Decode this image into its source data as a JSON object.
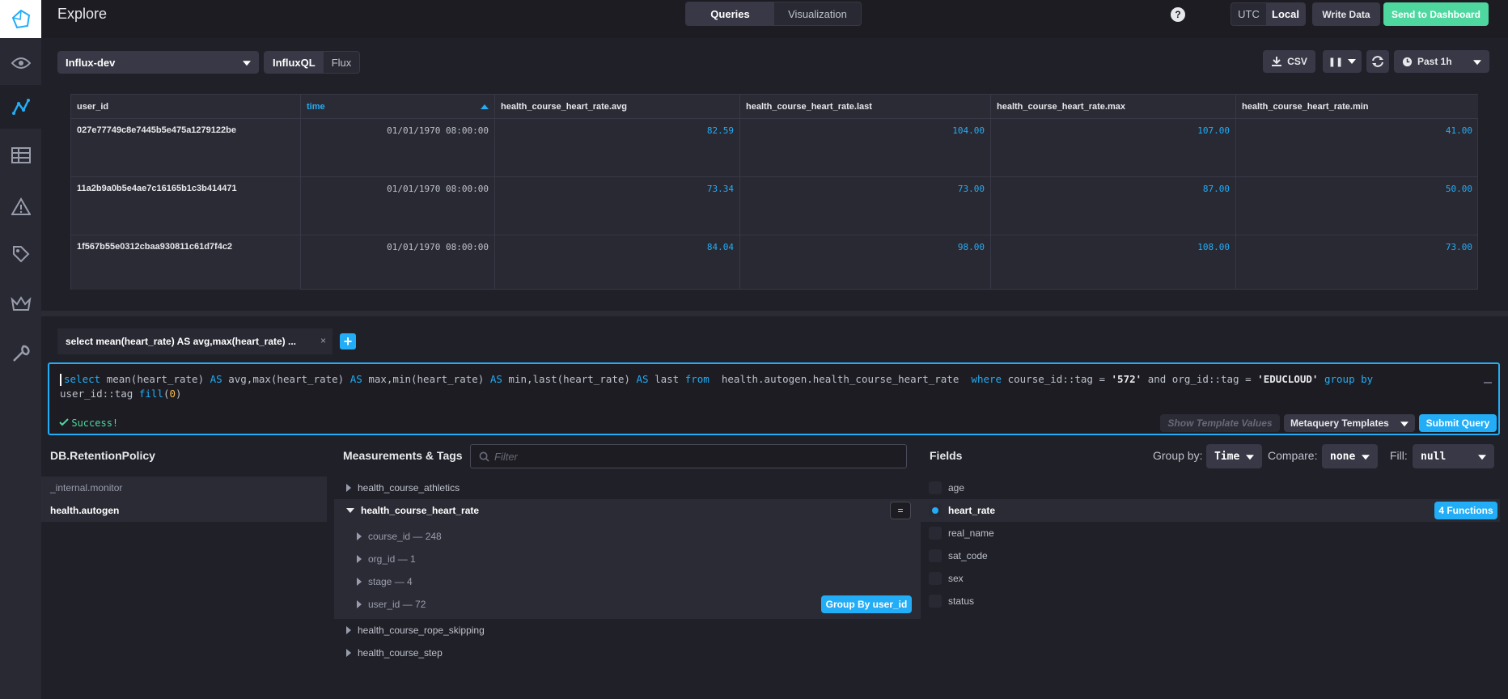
{
  "header": {
    "title": "Explore",
    "tabs": [
      "Queries",
      "Visualization"
    ],
    "tz": [
      "UTC",
      "Local"
    ],
    "write_data": "Write Data",
    "send_dashboard": "Send to Dashboard"
  },
  "toolbar": {
    "database": "Influx-dev",
    "lang": [
      "InfluxQL",
      "Flux"
    ],
    "csv": "CSV",
    "range": "Past 1h"
  },
  "table": {
    "headers": [
      "user_id",
      "time",
      "health_course_heart_rate.avg",
      "health_course_heart_rate.last",
      "health_course_heart_rate.max",
      "health_course_heart_rate.min"
    ],
    "rows": [
      {
        "id": "027e77749c8e7445b5e475a1279122be",
        "time": "01/01/1970 08:00:00",
        "avg": "82.59",
        "last": "104.00",
        "max": "107.00",
        "min": "41.00"
      },
      {
        "id": "11a2b9a0b5e4ae7c16165b1c3b414471",
        "time": "01/01/1970 08:00:00",
        "avg": "73.34",
        "last": "73.00",
        "max": "87.00",
        "min": "50.00"
      },
      {
        "id": "1f567b55e0312cbaa930811c61d7f4c2",
        "time": "01/01/1970 08:00:00",
        "avg": "84.04",
        "last": "98.00",
        "max": "108.00",
        "min": "73.00"
      }
    ]
  },
  "query": {
    "tab_label": "select mean(heart_rate) AS avg,max(heart_rate) ...",
    "tab_close": "×",
    "add": "+",
    "code": {
      "p1": "mean(heart_rate) ",
      "p2": " avg,max(heart_rate) ",
      "p3": " max,min(heart_rate) ",
      "p4": " min,last(heart_rate) ",
      "p5": " last ",
      "p6": "  health.autogen.health_course_heart_rate  ",
      "p7": " course_id::tag = ",
      "s1": "'572'",
      "p8": " and org_id::tag = ",
      "s2": "'EDUCLOUD'",
      "p9": "user_id::tag ",
      "p10": "(",
      "n1": "0",
      "p11": ")",
      "kw_select": "select",
      "kw_as": "AS",
      "kw_from": "from",
      "kw_where": "where",
      "kw_group": "group by",
      "kw_fill": "fill"
    },
    "status": "Success!",
    "show_template": "Show Template Values",
    "metaquery": "Metaquery Templates",
    "submit": "Submit Query"
  },
  "db_panel": {
    "title": "DB.RetentionPolicy",
    "items": [
      "_internal.monitor",
      "health.autogen"
    ]
  },
  "measurements": {
    "title": "Measurements & Tags",
    "filter_placeholder": "Filter",
    "items": [
      "health_course_athletics",
      "health_course_heart_rate",
      "health_course_rope_skipping",
      "health_course_step"
    ],
    "tags": [
      "course_id — 248",
      "org_id — 1",
      "stage — 4",
      "user_id — 72"
    ],
    "equals": "=",
    "group_by_btn": "Group By user_id"
  },
  "fields": {
    "title": "Fields",
    "group_by_label": "Group by:",
    "group_by_value": "Time",
    "compare_label": "Compare:",
    "compare_value": "none",
    "fill_label": "Fill:",
    "fill_value": "null",
    "items": [
      "age",
      "heart_rate",
      "real_name",
      "sat_code",
      "sex",
      "status"
    ],
    "functions_btn": "4 Functions"
  }
}
